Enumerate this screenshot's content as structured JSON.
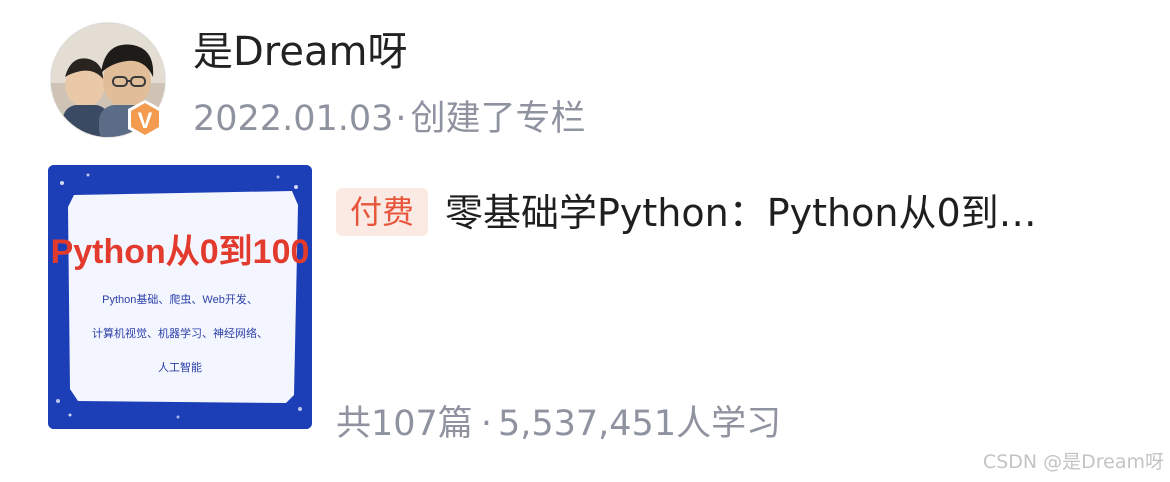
{
  "author": {
    "name": "是Dream呀",
    "date": "2022.01.03",
    "dot": "·",
    "action": "创建了专栏",
    "avatar_icon": "user-avatar-photo",
    "badge": {
      "icon": "vip-badge-icon",
      "letter": "V",
      "color": "#f39b4e"
    }
  },
  "column": {
    "tag": "付费",
    "title": "零基础学Python：Python从0到…",
    "cover": {
      "headline": "Python从0到100",
      "line1": "Python基础、爬虫、Web开发、",
      "line2": "计算机视觉、机器学习、神经网络、",
      "line3": "人工智能",
      "background_color": "#1c3fb8",
      "headline_color": "#e23b2e"
    },
    "count_text": "共107篇",
    "dot": "·",
    "learners_text": "5,537,451人学习"
  },
  "watermark": "CSDN @是Dream呀",
  "colors": {
    "tag_bg": "#fbe9e4",
    "tag_text": "#e7553a",
    "meta_text": "#8f93a0"
  }
}
